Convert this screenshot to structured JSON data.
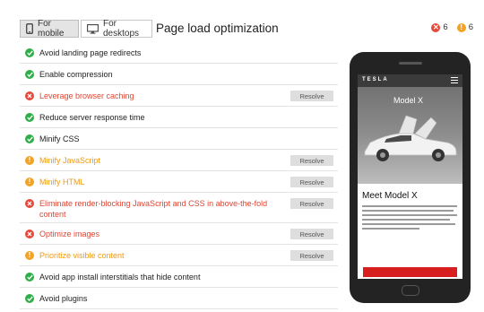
{
  "header": {
    "tabs": [
      {
        "label": "For mobile",
        "icon": "smartphone-icon",
        "active": true
      },
      {
        "label": "For desktops",
        "icon": "monitor-icon",
        "active": false
      }
    ],
    "title": "Page load optimization",
    "error_count": "6",
    "warning_count": "6"
  },
  "rules": [
    {
      "label": "Avoid landing page redirects",
      "status": "pass"
    },
    {
      "label": "Enable compression",
      "status": "pass"
    },
    {
      "label": "Leverage browser caching",
      "status": "fail",
      "action": "Resolve"
    },
    {
      "label": "Reduce server response time",
      "status": "pass"
    },
    {
      "label": "Minify CSS",
      "status": "pass"
    },
    {
      "label": "Minify JavaScript",
      "status": "warn",
      "action": "Resolve"
    },
    {
      "label": "Minify HTML",
      "status": "warn",
      "action": "Resolve"
    },
    {
      "label": "Eliminate render-blocking JavaScript and CSS in above-the-fold",
      "label_line2": "content",
      "status": "fail",
      "action": "Resolve"
    },
    {
      "label": "Optimize images",
      "status": "fail",
      "action": "Resolve"
    },
    {
      "label": "Prioritize visible content",
      "status": "warn",
      "action": "Resolve"
    },
    {
      "label": "Avoid app install interstitials that hide content",
      "status": "pass"
    },
    {
      "label": "Avoid plugins",
      "status": "pass"
    }
  ],
  "preview": {
    "brand": "TESLA",
    "hero_model": "Model X",
    "content_title": "Meet Model X"
  },
  "colors": {
    "pass": "#2fae49",
    "fail": "#e8483a",
    "warn": "#f4a223"
  }
}
